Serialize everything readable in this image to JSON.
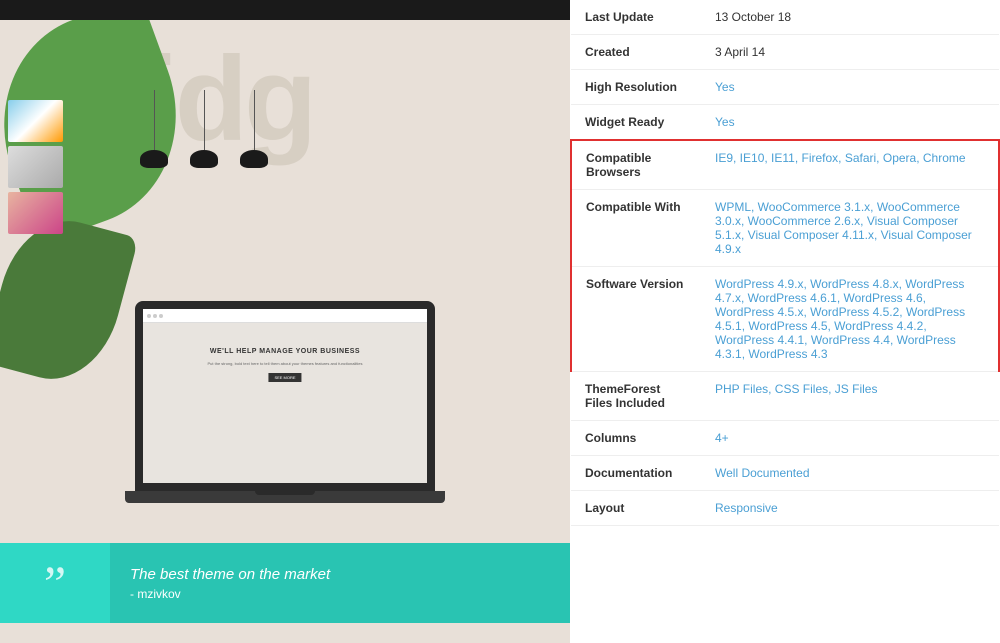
{
  "left": {
    "bridge_text": "Bridg",
    "quote": {
      "mark": "”",
      "text": "The best theme on the market",
      "author": "- mzivkov"
    },
    "screen": {
      "hero": "WE'LL HELP MANAGE YOUR BUSINESS",
      "sub": "Put the strong, bold text here to tell them about your themes features and functionalities",
      "btn": "SEE MORE"
    }
  },
  "right": {
    "rows": [
      {
        "id": "last-update",
        "label": "Last Update",
        "value": "13 October 18",
        "link": false,
        "highlight": false
      },
      {
        "id": "created",
        "label": "Created",
        "value": "3 April 14",
        "link": false,
        "highlight": false
      },
      {
        "id": "high-resolution",
        "label": "High Resolution",
        "value": "Yes",
        "link": true,
        "highlight": false
      },
      {
        "id": "widget-ready",
        "label": "Widget Ready",
        "value": "Yes",
        "link": true,
        "highlight": false
      }
    ],
    "highlighted": {
      "compatible_browsers": {
        "label": "Compatible Browsers",
        "value": "IE9, IE10, IE11, Firefox, Safari, Opera, Chrome"
      },
      "compatible_with": {
        "label": "Compatible With",
        "value": "WPML, WooCommerce 3.1.x, WooCommerce 3.0.x, WooCommerce 2.6.x, Visual Composer 5.1.x, Visual Composer 4.11.x, Visual Composer 4.9.x"
      },
      "software_version": {
        "label": "Software Version",
        "value": "WordPress 4.9.x, WordPress 4.8.x, WordPress 4.7.x, WordPress 4.6.1, WordPress 4.6, WordPress 4.5.x, WordPress 4.5.2, WordPress 4.5.1, WordPress 4.5, WordPress 4.4.2, WordPress 4.4.1, WordPress 4.4, WordPress 4.3.1, WordPress 4.3"
      }
    },
    "rows_after": [
      {
        "id": "themeforest-files",
        "label": "ThemeForest Files Included",
        "value": "PHP Files, CSS Files, JS Files",
        "link": true
      },
      {
        "id": "columns",
        "label": "Columns",
        "value": "4+",
        "link": true
      },
      {
        "id": "documentation",
        "label": "Documentation",
        "value": "Well Documented",
        "link": true
      },
      {
        "id": "layout",
        "label": "Layout",
        "value": "Responsive",
        "link": true
      }
    ]
  }
}
